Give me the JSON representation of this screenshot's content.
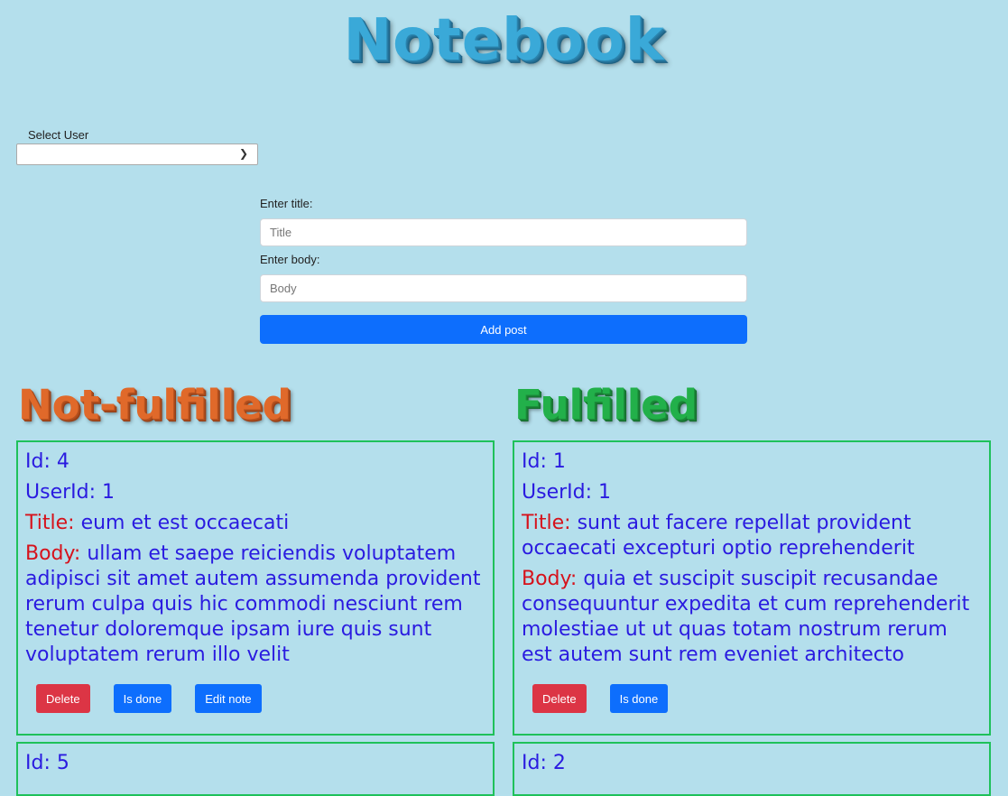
{
  "header": {
    "title": "Notebook"
  },
  "user_select": {
    "label": "Select User",
    "value": ""
  },
  "form": {
    "title_label": "Enter title:",
    "title_placeholder": "Title",
    "body_label": "Enter body:",
    "body_placeholder": "Body",
    "add_label": "Add post"
  },
  "sections": {
    "not_fulfilled": "Not-fulfilled",
    "fulfilled": "Fulfilled"
  },
  "labels": {
    "title": "Title:",
    "body": "Body:"
  },
  "buttons": {
    "delete": "Delete",
    "is_done": "Is done",
    "edit": "Edit note"
  },
  "not_fulfilled_notes": [
    {
      "id": "Id: 4",
      "user_id": "UserId: 1",
      "title": "eum et est occaecati",
      "body": "ullam et saepe reiciendis voluptatem adipisci sit amet autem assumenda provident rerum culpa quis hic commodi nesciunt rem tenetur doloremque ipsam iure quis sunt voluptatem rerum illo velit"
    },
    {
      "id": "Id: 5"
    }
  ],
  "fulfilled_notes": [
    {
      "id": "Id: 1",
      "user_id": "UserId: 1",
      "title": "sunt aut facere repellat provident occaecati excepturi optio reprehenderit",
      "body": "quia et suscipit suscipit recusandae consequuntur expedita et cum reprehenderit molestiae ut ut quas totam nostrum rerum est autem sunt rem eveniet architecto"
    },
    {
      "id": "Id: 2"
    }
  ],
  "colors": {
    "background": "#b4dfec",
    "card_border": "#1fc15a",
    "text": "#2a1be0",
    "label": "#d6121b",
    "primary": "#0d6efd",
    "danger": "#dc3545"
  }
}
